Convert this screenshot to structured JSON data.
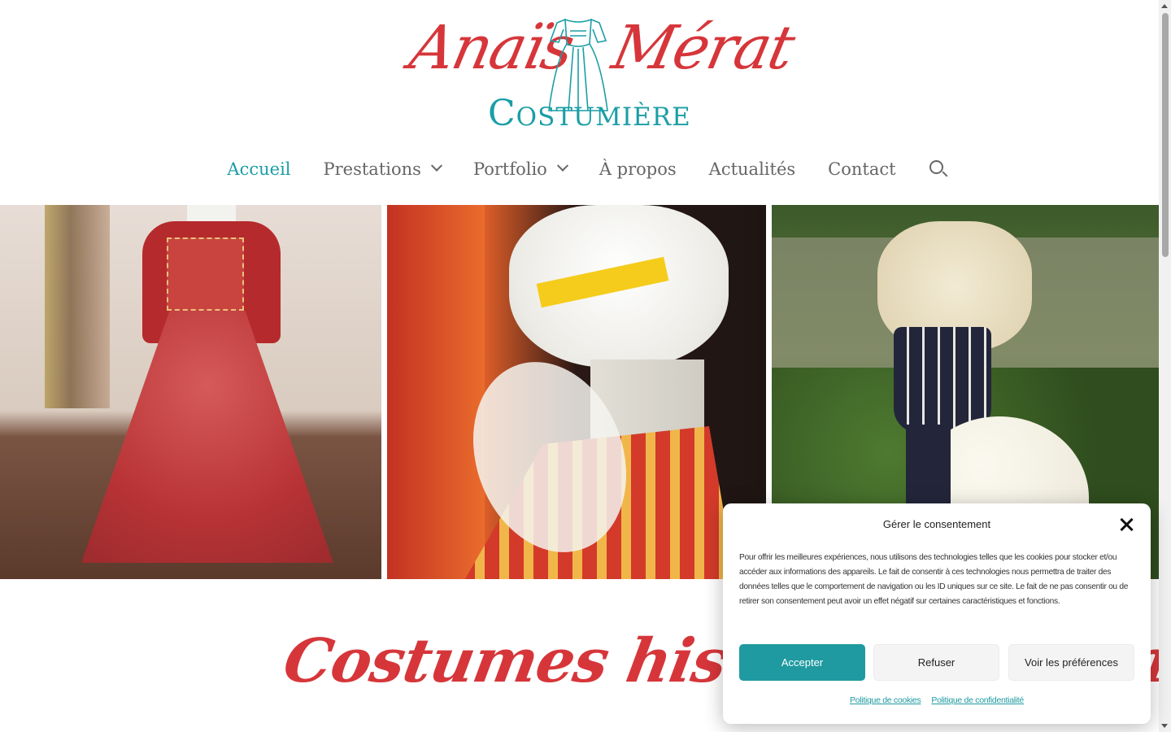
{
  "site": {
    "logo_first": "Anaïs",
    "logo_last": "Mérat",
    "logo_subtitle": "Costumière",
    "brand_red": "#d6363a",
    "brand_teal": "#1a9ea5"
  },
  "nav": {
    "items": [
      {
        "label": "Accueil",
        "active": true
      },
      {
        "label": "Prestations",
        "dropdown": true
      },
      {
        "label": "Portfolio",
        "dropdown": true
      },
      {
        "label": "À propos"
      },
      {
        "label": "Actualités"
      },
      {
        "label": "Contact"
      }
    ],
    "search_icon": "search-icon"
  },
  "gallery": {
    "photos": [
      "renaissance-red-gown",
      "18th-century-cap-and-stays",
      "corset-and-bustle-on-mannequin"
    ]
  },
  "heading": "Costumes historiques et fa",
  "consent": {
    "title": "Gérer le consentement",
    "text": "Pour offrir les meilleures expériences, nous utilisons des technologies telles que les cookies pour stocker et/ou accéder aux informations des appareils. Le fait de consentir à ces technologies nous permettra de traiter des données telles que le comportement de navigation ou les ID uniques sur ce site. Le fait de ne pas consentir ou de retirer son consentement peut avoir un effet négatif sur certaines caractéristiques et fonctions.",
    "accept": "Accepter",
    "refuse": "Refuser",
    "preferences": "Voir les préférences",
    "cookie_policy": "Politique de cookies",
    "privacy_policy": "Politique de confidentialité",
    "accent": "#1e9aa0"
  }
}
